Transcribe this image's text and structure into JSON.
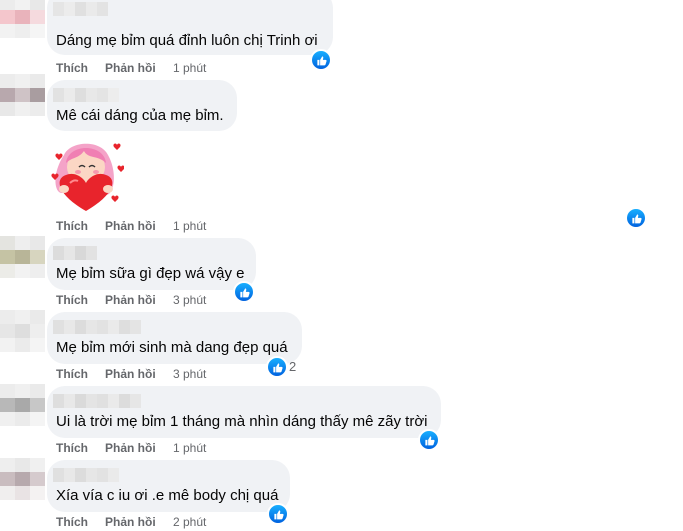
{
  "comments": [
    {
      "text": "Dáng mẹ bỉm quá đỉnh luôn chị Trinh ơi",
      "like": "Thích",
      "reply": "Phản hồi",
      "time": "1 phút"
    },
    {
      "text": "Mê cái dáng của mẹ bỉm.",
      "like": "Thích",
      "reply": "Phản hồi",
      "time": "1 phút",
      "sticker": "heart-girl-sticker"
    },
    {
      "text": "Mẹ bỉm sữa gì đẹp wá vậy e",
      "like": "Thích",
      "reply": "Phản hồi",
      "time": "3 phút"
    },
    {
      "text": "Mẹ bỉm mới sinh mà dang đẹp quá",
      "like": "Thích",
      "reply": "Phản hồi",
      "time": "3 phút",
      "reaction_count": "2"
    },
    {
      "text": "Ui là trời mẹ bỉm 1 tháng mà nhìn dáng thấy mê zãy trời",
      "like": "Thích",
      "reply": "Phản hồi",
      "time": "1 phút"
    },
    {
      "text": "Xía vía c iu ơi .e mê body chị quá",
      "like": "Thích",
      "reply": "Phản hồi",
      "time": "2 phút"
    }
  ],
  "icons": {
    "reaction": "like-reaction-icon",
    "sticker": "heart-girl-sticker"
  },
  "colors": {
    "bubble": "#f0f2f5",
    "meta": "#65676b",
    "like_blue": "#0866ff"
  }
}
